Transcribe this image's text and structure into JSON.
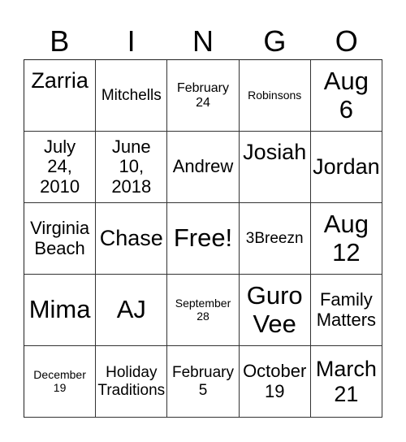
{
  "header": {
    "letters": [
      "B",
      "I",
      "N",
      "G",
      "O"
    ]
  },
  "board": {
    "rows": [
      [
        {
          "text": "Zarria",
          "size": "xl",
          "valign": "top"
        },
        {
          "text": "Mitchells",
          "size": "m",
          "valign": "center"
        },
        {
          "text": "February\n24",
          "size": "s",
          "valign": "center"
        },
        {
          "text": "Robinsons",
          "size": "xs",
          "valign": "center"
        },
        {
          "text": "Aug\n6",
          "size": "xxl",
          "valign": "center"
        }
      ],
      [
        {
          "text": "July\n24,\n2010",
          "size": "l",
          "valign": "center"
        },
        {
          "text": "June\n10,\n2018",
          "size": "l",
          "valign": "center"
        },
        {
          "text": "Andrew",
          "size": "l",
          "valign": "center"
        },
        {
          "text": "Josiah",
          "size": "xl",
          "valign": "top"
        },
        {
          "text": "Jordan",
          "size": "xl",
          "valign": "center"
        }
      ],
      [
        {
          "text": "Virginia\nBeach",
          "size": "l",
          "valign": "center"
        },
        {
          "text": "Chase",
          "size": "xl",
          "valign": "center"
        },
        {
          "text": "Free!",
          "size": "xxl",
          "valign": "center"
        },
        {
          "text": "3Breezn",
          "size": "m",
          "valign": "center"
        },
        {
          "text": "Aug\n12",
          "size": "xxl",
          "valign": "center"
        }
      ],
      [
        {
          "text": "Mima",
          "size": "xxl",
          "valign": "center"
        },
        {
          "text": "AJ",
          "size": "xxl",
          "valign": "center"
        },
        {
          "text": "September\n28",
          "size": "xs",
          "valign": "center"
        },
        {
          "text": "Guro\nVee",
          "size": "xxl",
          "valign": "center"
        },
        {
          "text": "Family\nMatters",
          "size": "l",
          "valign": "center"
        }
      ],
      [
        {
          "text": "December\n19",
          "size": "xs",
          "valign": "center"
        },
        {
          "text": "Holiday\nTraditions",
          "size": "m",
          "valign": "center"
        },
        {
          "text": "February\n5",
          "size": "m",
          "valign": "center"
        },
        {
          "text": "October\n19",
          "size": "l",
          "valign": "center"
        },
        {
          "text": "March\n21",
          "size": "xl",
          "valign": "center"
        }
      ]
    ]
  }
}
